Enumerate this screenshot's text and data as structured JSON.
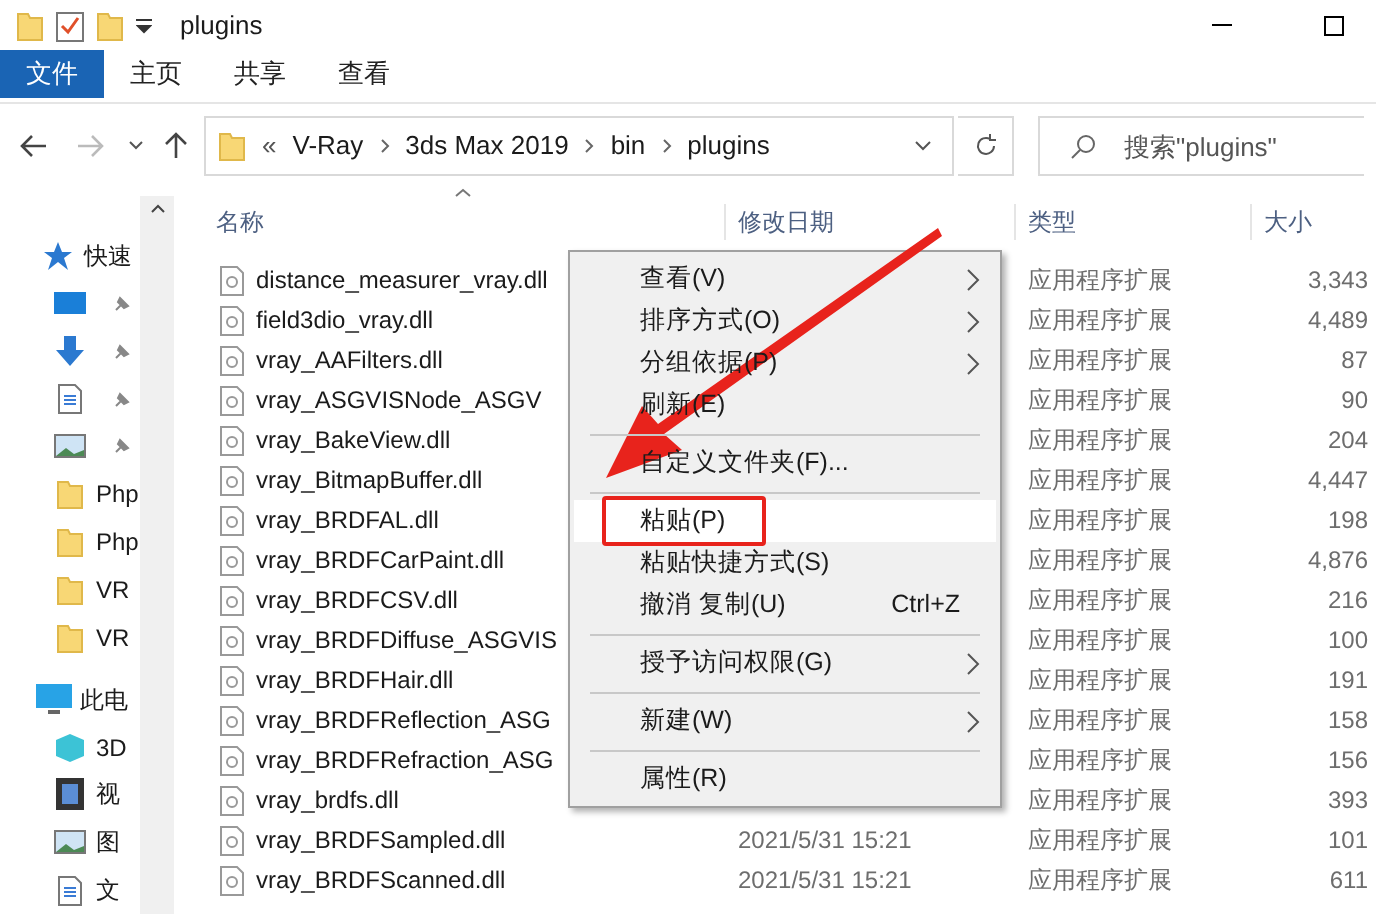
{
  "window": {
    "title": "plugins"
  },
  "ribbon_tabs": [
    {
      "label": "文件",
      "selected": true
    },
    {
      "label": "主页",
      "selected": false
    },
    {
      "label": "共享",
      "selected": false
    },
    {
      "label": "查看",
      "selected": false
    }
  ],
  "address": {
    "overflow": "«",
    "crumbs": [
      "V-Ray",
      "3ds Max 2019",
      "bin",
      "plugins"
    ]
  },
  "search": {
    "placeholder": "搜索\"plugins\""
  },
  "sidebar": [
    {
      "label": "快速",
      "kind": "star",
      "pinned": false
    },
    {
      "kind": "desktop",
      "pinned": true
    },
    {
      "kind": "download",
      "pinned": true
    },
    {
      "kind": "doc",
      "pinned": true
    },
    {
      "kind": "image",
      "pinned": true
    },
    {
      "label": "Php",
      "kind": "folder",
      "pinned": false
    },
    {
      "label": "Php",
      "kind": "folder",
      "pinned": false
    },
    {
      "label": "VR",
      "kind": "folder",
      "pinned": false
    },
    {
      "label": "VR",
      "kind": "folder",
      "pinned": false
    },
    {
      "label": "此电",
      "kind": "pc",
      "pinned": false
    },
    {
      "label": "3D",
      "kind": "cube",
      "pinned": false
    },
    {
      "label": "视",
      "kind": "video",
      "pinned": false
    },
    {
      "label": "图",
      "kind": "image",
      "pinned": false
    },
    {
      "label": "文",
      "kind": "doc",
      "pinned": false
    }
  ],
  "table": {
    "columns": [
      "名称",
      "修改日期",
      "类型",
      "大小"
    ],
    "rows": [
      {
        "name": "distance_measurer_vray.dll",
        "type": "应用程序扩展",
        "size": "3,343"
      },
      {
        "name": "field3dio_vray.dll",
        "type": "应用程序扩展",
        "size": "4,489"
      },
      {
        "name": "vray_AAFilters.dll",
        "type": "应用程序扩展",
        "size": "87"
      },
      {
        "name": "vray_ASGVISNode_ASGV",
        "type": "应用程序扩展",
        "size": "90"
      },
      {
        "name": "vray_BakeView.dll",
        "type": "应用程序扩展",
        "size": "204"
      },
      {
        "name": "vray_BitmapBuffer.dll",
        "type": "应用程序扩展",
        "size": "4,447"
      },
      {
        "name": "vray_BRDFAL.dll",
        "type": "应用程序扩展",
        "size": "198"
      },
      {
        "name": "vray_BRDFCarPaint.dll",
        "type": "应用程序扩展",
        "size": "4,876"
      },
      {
        "name": "vray_BRDFCSV.dll",
        "type": "应用程序扩展",
        "size": "216"
      },
      {
        "name": "vray_BRDFDiffuse_ASGVIS",
        "type": "应用程序扩展",
        "size": "100"
      },
      {
        "name": "vray_BRDFHair.dll",
        "type": "应用程序扩展",
        "size": "191"
      },
      {
        "name": "vray_BRDFReflection_ASG",
        "type": "应用程序扩展",
        "size": "158"
      },
      {
        "name": "vray_BRDFRefraction_ASG",
        "type": "应用程序扩展",
        "size": "156"
      },
      {
        "name": "vray_brdfs.dll",
        "type": "应用程序扩展",
        "size": "393"
      },
      {
        "name": "vray_BRDFSampled.dll",
        "date": "2021/5/31 15:21",
        "type": "应用程序扩展",
        "size": "101"
      },
      {
        "name": "vray_BRDFScanned.dll",
        "date": "2021/5/31 15:21",
        "type": "应用程序扩展",
        "size": "611"
      }
    ]
  },
  "context_menu": [
    {
      "kind": "item",
      "label": "查看(V)",
      "submenu": true,
      "selected": false
    },
    {
      "kind": "item",
      "label": "排序方式(O)",
      "submenu": true,
      "selected": false
    },
    {
      "kind": "item",
      "label": "分组依据(P)",
      "submenu": true,
      "selected": false
    },
    {
      "kind": "item",
      "label": "刷新(E)",
      "submenu": false,
      "selected": false
    },
    {
      "kind": "separator"
    },
    {
      "kind": "item",
      "label": "自定义文件夹(F)...",
      "submenu": false,
      "selected": false
    },
    {
      "kind": "separator"
    },
    {
      "kind": "item",
      "label": "粘贴(P)",
      "submenu": false,
      "selected": true
    },
    {
      "kind": "item",
      "label": "粘贴快捷方式(S)",
      "submenu": false,
      "selected": false
    },
    {
      "kind": "item",
      "label": "撤消 复制(U)",
      "shortcut": "Ctrl+Z",
      "submenu": false,
      "selected": false
    },
    {
      "kind": "separator"
    },
    {
      "kind": "item",
      "label": "授予访问权限(G)",
      "submenu": true,
      "selected": false
    },
    {
      "kind": "separator"
    },
    {
      "kind": "item",
      "label": "新建(W)",
      "submenu": true,
      "selected": false
    },
    {
      "kind": "separator"
    },
    {
      "kind": "item",
      "label": "属性(R)",
      "submenu": false,
      "selected": false
    }
  ]
}
